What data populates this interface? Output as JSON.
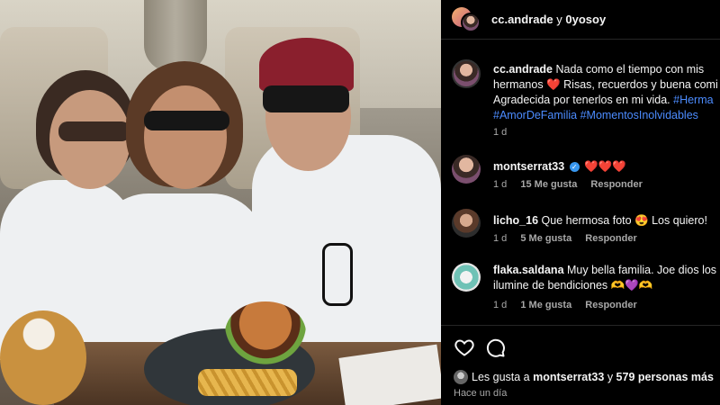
{
  "post": {
    "accounts_title": {
      "user1": "cc.andrade",
      "joiner": "y",
      "user2": "0yosoy"
    },
    "caption": {
      "username": "cc.andrade",
      "line1": "Nada como el tiempo con mis",
      "line2_a": "hermanos",
      "line2_emoji": "❤️",
      "line2_b": "Risas, recuerdos y buena comi",
      "line3_a": "Agradecida por tenerlos en mi vida.",
      "line3_tag": "#Herma",
      "line4_tag1": "#AmorDeFamilia",
      "line4_tag2": "#MomentosInolvidables",
      "time": "1 d"
    },
    "comments": [
      {
        "username": "montserrat33",
        "verified": true,
        "text": "❤️❤️❤️",
        "time": "1 d",
        "likes": "15 Me gusta",
        "reply": "Responder"
      },
      {
        "username": "licho_16",
        "verified": false,
        "text": "Que hermosa foto 😍 Los quiero!",
        "time": "1 d",
        "likes": "5 Me gusta",
        "reply": "Responder"
      },
      {
        "username": "flaka.saldana",
        "verified": false,
        "text_line1": "Muy bella familia. Joe dios los",
        "text_line2": "ilumine de bendiciones 🫶💜🫶",
        "time": "1 d",
        "likes": "1 Me gusta",
        "reply": "Responder"
      }
    ],
    "likes_summary": {
      "prefix": "Les gusta a",
      "user": "montserrat33",
      "middle": "y",
      "count": "579 personas más"
    },
    "posted_ago": "Hace un día"
  },
  "icons": {
    "like": "heart-outline-icon",
    "comment": "comment-bubble-icon",
    "comment_like": "small-heart-icon",
    "verified": "verified-badge-icon"
  },
  "colors": {
    "hashtag": "#4c8cff",
    "verified": "#3897f0",
    "background": "#000000",
    "meta": "#a8a8a8"
  }
}
